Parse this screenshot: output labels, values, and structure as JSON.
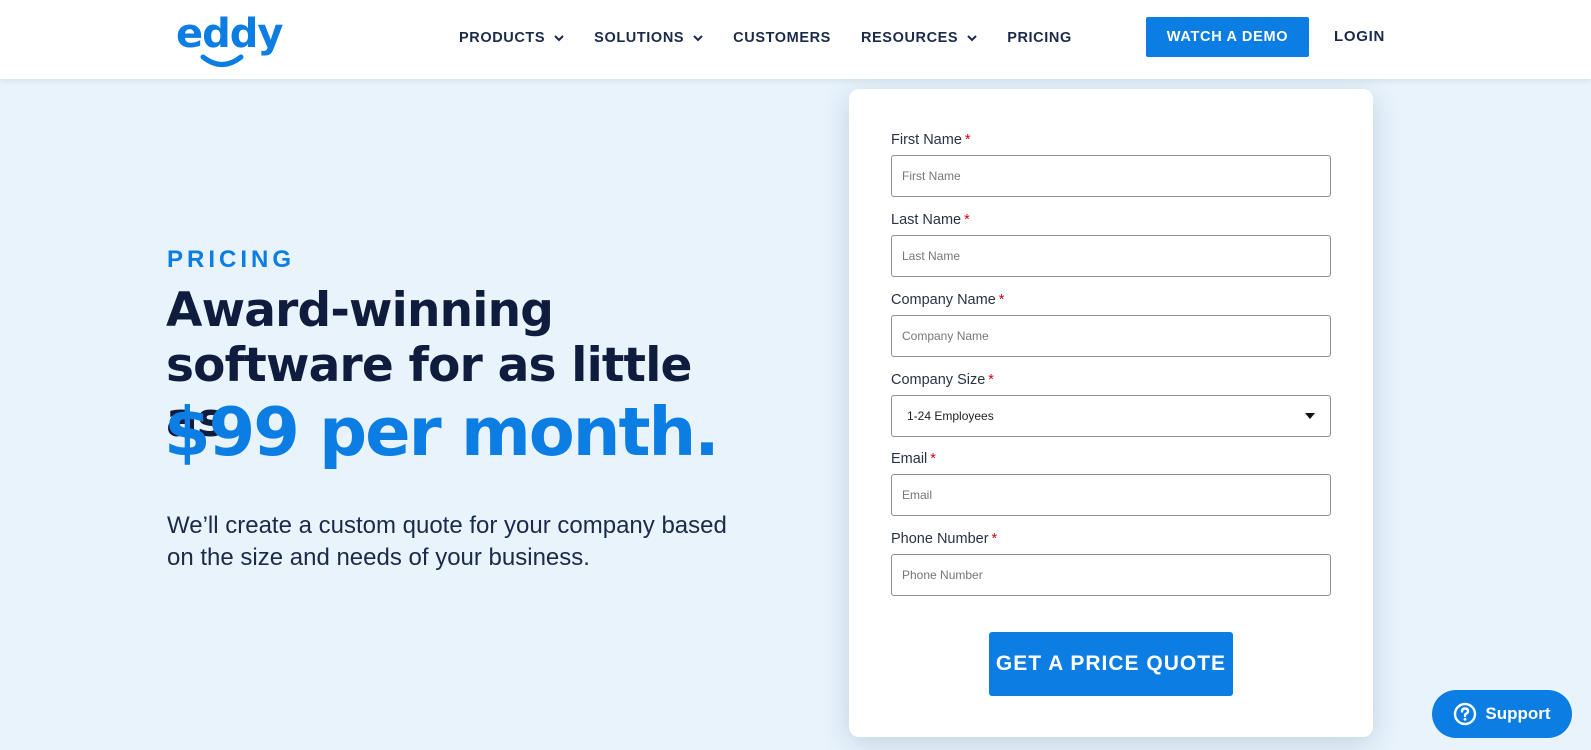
{
  "brand": {
    "logo_text": "eddy",
    "accent_color": "#0b7de3",
    "logo_icon": "smile-icon"
  },
  "nav": {
    "items": [
      {
        "label": "PRODUCTS",
        "has_dropdown": true
      },
      {
        "label": "SOLUTIONS",
        "has_dropdown": true
      },
      {
        "label": "CUSTOMERS",
        "has_dropdown": false
      },
      {
        "label": "RESOURCES",
        "has_dropdown": true
      },
      {
        "label": "PRICING",
        "has_dropdown": false
      }
    ],
    "demo_button": "WATCH A DEMO",
    "login": "LOGIN"
  },
  "hero": {
    "eyebrow": "PRICING",
    "headline": "Award-winning software for as little as",
    "price": "$99 per month.",
    "subtext": "We’ll create a custom quote for your company based on the size and needs of your business."
  },
  "form": {
    "required_mark": "*",
    "first_name": {
      "label": "First Name",
      "placeholder": "First Name",
      "value": ""
    },
    "last_name": {
      "label": "Last Name",
      "placeholder": "Last Name",
      "value": ""
    },
    "company_name": {
      "label": "Company Name",
      "placeholder": "Company Name",
      "value": ""
    },
    "company_size": {
      "label": "Company Size",
      "selected": "1-24 Employees"
    },
    "email": {
      "label": "Email",
      "placeholder": "Email",
      "value": ""
    },
    "phone": {
      "label": "Phone Number",
      "placeholder": "Phone Number",
      "value": ""
    },
    "submit": "GET A PRICE QUOTE"
  },
  "support": {
    "label": "Support",
    "icon": "question-circle-icon"
  }
}
